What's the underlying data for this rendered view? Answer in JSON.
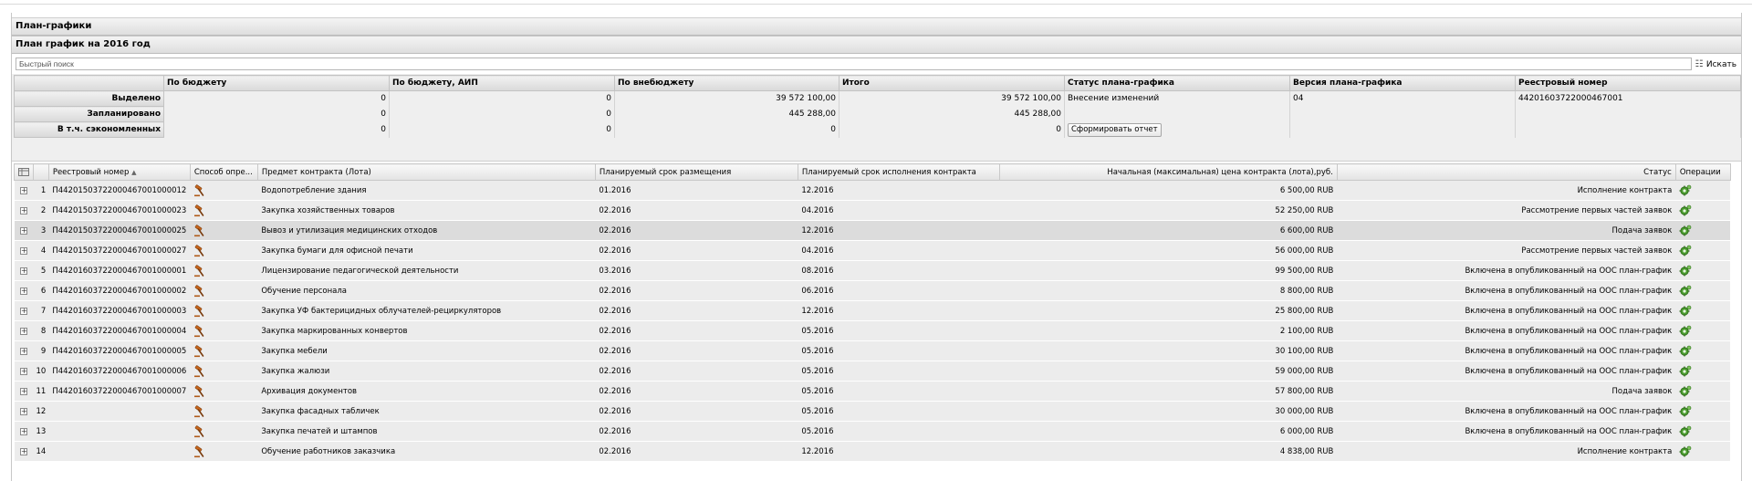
{
  "panel": {
    "title": "План-графики",
    "subtitle": "План график на 2016 год"
  },
  "search": {
    "placeholder": "Быстрый поиск",
    "button_label": "Искать",
    "button_icon": "binoculars-icon"
  },
  "summary": {
    "headers": [
      "По бюджету",
      "По бюджету, АИП",
      "По внебюджету",
      "Итого",
      "Статус плана-графика",
      "Версия плана-графика",
      "Реестровый номер"
    ],
    "rows": [
      {
        "label": "Выделено",
        "budget": "0",
        "budget_aip": "0",
        "extra_budget": "39 572 100,00",
        "total": "39 572 100,00",
        "status": "Внесение изменений",
        "version": "04",
        "reg_number": "44201603722000467001"
      },
      {
        "label": "Запланировано",
        "budget": "0",
        "budget_aip": "0",
        "extra_budget": "445 288,00",
        "total": "445 288,00",
        "status": "",
        "version": "",
        "reg_number": ""
      },
      {
        "label": "В т.ч. сэкономленных",
        "budget": "0",
        "budget_aip": "0",
        "extra_budget": "0",
        "total": "0",
        "status": "",
        "version": "",
        "reg_number": ""
      }
    ],
    "generate_report_label": "Сформировать отчет"
  },
  "grid": {
    "columns": {
      "reg_number": "Реестровый номер",
      "method": "Способ опре...",
      "subject": "Предмет контракта (Лота)",
      "placement": "Планируемый срок размещения",
      "execution": "Планируемый срок исполнения контракта",
      "price": "Начальная (максимальная) цена контракта (лота),руб.",
      "status": "Статус",
      "ops": "Операции"
    },
    "rows": [
      {
        "n": "1",
        "reg": "П44201503722000467001000012",
        "subject": "Водопотребление здания",
        "placement": "01.2016",
        "execution": "12.2016",
        "price": "6 500,00 RUB",
        "status": "Исполнение контракта"
      },
      {
        "n": "2",
        "reg": "П44201503722000467001000023",
        "subject": "Закупка хозяйственных товаров",
        "placement": "02.2016",
        "execution": "04.2016",
        "price": "52 250,00 RUB",
        "status": "Рассмотрение первых частей заявок"
      },
      {
        "n": "3",
        "reg": "П44201503722000467001000025",
        "subject": "Вывоз и утилизация медицинских отходов",
        "placement": "02.2016",
        "execution": "12.2016",
        "price": "6 600,00 RUB",
        "status": "Подача заявок"
      },
      {
        "n": "4",
        "reg": "П44201503722000467001000027",
        "subject": "Закупка бумаги для офисной печати",
        "placement": "02.2016",
        "execution": "04.2016",
        "price": "56 000,00 RUB",
        "status": "Рассмотрение первых частей заявок"
      },
      {
        "n": "5",
        "reg": "П44201603722000467001000001",
        "subject": "Лицензирование педагогической деятельности",
        "placement": "03.2016",
        "execution": "08.2016",
        "price": "99 500,00 RUB",
        "status": "Включена в опубликованный на ООС план-график"
      },
      {
        "n": "6",
        "reg": "П44201603722000467001000002",
        "subject": "Обучение персонала",
        "placement": "02.2016",
        "execution": "06.2016",
        "price": "8 800,00 RUB",
        "status": "Включена в опубликованный на ООС план-график"
      },
      {
        "n": "7",
        "reg": "П44201603722000467001000003",
        "subject": "Закупка УФ бактерицидных облучателей-рециркуляторов",
        "placement": "02.2016",
        "execution": "12.2016",
        "price": "25 800,00 RUB",
        "status": "Включена в опубликованный на ООС план-график"
      },
      {
        "n": "8",
        "reg": "П44201603722000467001000004",
        "subject": "Закупка маркированных конвертов",
        "placement": "02.2016",
        "execution": "05.2016",
        "price": "2 100,00 RUB",
        "status": "Включена в опубликованный на ООС план-график"
      },
      {
        "n": "9",
        "reg": "П44201603722000467001000005",
        "subject": "Закупка мебели",
        "placement": "02.2016",
        "execution": "05.2016",
        "price": "30 100,00 RUB",
        "status": "Включена в опубликованный на ООС план-график"
      },
      {
        "n": "10",
        "reg": "П44201603722000467001000006",
        "subject": "Закупка жалюзи",
        "placement": "02.2016",
        "execution": "05.2016",
        "price": "59 000,00 RUB",
        "status": "Включена в опубликованный на ООС план-график"
      },
      {
        "n": "11",
        "reg": "П44201603722000467001000007",
        "subject": "Архивация документов",
        "placement": "02.2016",
        "execution": "05.2016",
        "price": "57 800,00 RUB",
        "status": "Подача заявок"
      },
      {
        "n": "12",
        "reg": "",
        "subject": "Закупка фасадных табличек",
        "placement": "02.2016",
        "execution": "05.2016",
        "price": "30 000,00 RUB",
        "status": "Включена в опубликованный на ООС план-график"
      },
      {
        "n": "13",
        "reg": "",
        "subject": "Закупка печатей и штампов",
        "placement": "02.2016",
        "execution": "05.2016",
        "price": "6 000,00 RUB",
        "status": "Включена в опубликованный на ООС план-график"
      },
      {
        "n": "14",
        "reg": "",
        "subject": "Обучение работников заказчика",
        "placement": "02.2016",
        "execution": "12.2016",
        "price": "4 838,00 RUB",
        "status": "Исполнение контракта"
      }
    ]
  }
}
